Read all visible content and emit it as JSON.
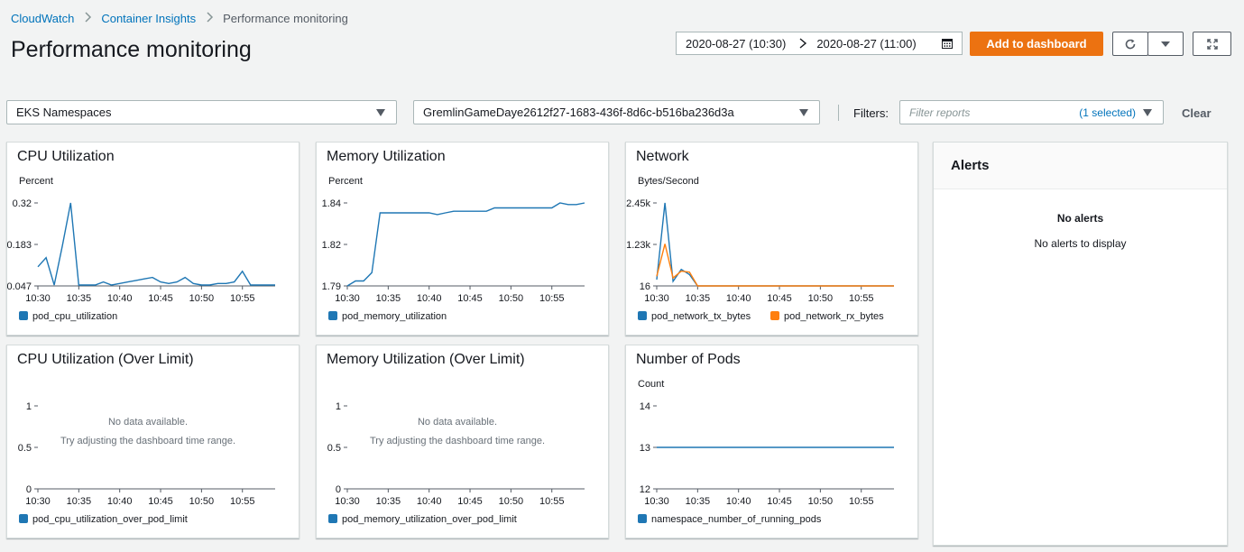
{
  "breadcrumb": {
    "items": [
      "CloudWatch",
      "Container Insights"
    ],
    "current": "Performance monitoring"
  },
  "page": {
    "title": "Performance monitoring"
  },
  "time_range": {
    "start": "2020-08-27 (10:30)",
    "end": "2020-08-27 (11:00)"
  },
  "actions": {
    "add_dashboard": "Add to dashboard"
  },
  "selectors": {
    "resource_type": "EKS Namespaces",
    "cluster": "GremlinGameDaye2612f27-1683-436f-8d6c-b516ba236d3a",
    "filters_label": "Filters:",
    "filter_placeholder": "Filter reports",
    "filter_selected": "(1 selected)",
    "clear": "Clear"
  },
  "colors": {
    "series_blue": "#1f77b4",
    "series_orange": "#ff7f0e",
    "accent": "#ec7211",
    "link": "#0073bb"
  },
  "alerts": {
    "title": "Alerts",
    "heading": "No alerts",
    "message": "No alerts to display"
  },
  "charts": {
    "cpu": {
      "title": "CPU Utilization",
      "unit": "Percent",
      "xticks": [
        "10:30",
        "10:35",
        "10:40",
        "10:45",
        "10:50",
        "10:55"
      ],
      "yticks": [
        "0.32",
        "0.183",
        "0.047"
      ],
      "legend": [
        "pod_cpu_utilization"
      ]
    },
    "mem": {
      "title": "Memory Utilization",
      "unit": "Percent",
      "xticks": [
        "10:30",
        "10:35",
        "10:40",
        "10:45",
        "10:50",
        "10:55"
      ],
      "yticks": [
        "1.84",
        "1.82",
        "1.79"
      ],
      "legend": [
        "pod_memory_utilization"
      ]
    },
    "net": {
      "title": "Network",
      "unit": "Bytes/Second",
      "xticks": [
        "10:30",
        "10:35",
        "10:40",
        "10:45",
        "10:50",
        "10:55"
      ],
      "yticks": [
        "2.45k",
        "1.23k",
        "16"
      ],
      "legend": [
        "pod_network_tx_bytes",
        "pod_network_rx_bytes"
      ]
    },
    "cpu_limit": {
      "title": "CPU Utilization (Over Limit)",
      "xticks": [
        "10:30",
        "10:35",
        "10:40",
        "10:45",
        "10:50",
        "10:55"
      ],
      "yticks": [
        "1",
        "0.5",
        "0"
      ],
      "nodata": "No data available.",
      "nodata_hint": "Try adjusting the dashboard time range.",
      "legend": [
        "pod_cpu_utilization_over_pod_limit"
      ]
    },
    "mem_limit": {
      "title": "Memory Utilization (Over Limit)",
      "xticks": [
        "10:30",
        "10:35",
        "10:40",
        "10:45",
        "10:50",
        "10:55"
      ],
      "yticks": [
        "1",
        "0.5",
        "0"
      ],
      "nodata": "No data available.",
      "nodata_hint": "Try adjusting the dashboard time range.",
      "legend": [
        "pod_memory_utilization_over_pod_limit"
      ]
    },
    "pods": {
      "title": "Number of Pods",
      "unit": "Count",
      "xticks": [
        "10:30",
        "10:35",
        "10:40",
        "10:45",
        "10:50",
        "10:55"
      ],
      "yticks": [
        "14",
        "13",
        "12"
      ],
      "legend": [
        "namespace_number_of_running_pods"
      ]
    }
  },
  "chart_data": [
    {
      "type": "line",
      "title": "CPU Utilization",
      "ylabel": "Percent",
      "x": [
        "10:30",
        "10:31",
        "10:32",
        "10:33",
        "10:34",
        "10:35",
        "10:36",
        "10:37",
        "10:38",
        "10:39",
        "10:40",
        "10:41",
        "10:42",
        "10:43",
        "10:44",
        "10:45",
        "10:46",
        "10:47",
        "10:48",
        "10:49",
        "10:50",
        "10:51",
        "10:52",
        "10:53",
        "10:54",
        "10:55",
        "10:56",
        "10:57",
        "10:58",
        "10:59"
      ],
      "series": [
        {
          "name": "pod_cpu_utilization",
          "values": [
            0.11,
            0.14,
            0.05,
            0.18,
            0.32,
            0.05,
            0.05,
            0.05,
            0.06,
            0.05,
            0.055,
            0.06,
            0.065,
            0.07,
            0.075,
            0.06,
            0.055,
            0.06,
            0.075,
            0.055,
            0.05,
            0.05,
            0.055,
            0.055,
            0.06,
            0.095,
            0.05,
            0.05,
            0.05,
            0.05
          ]
        }
      ],
      "ylim": [
        0.047,
        0.32
      ]
    },
    {
      "type": "line",
      "title": "Memory Utilization",
      "ylabel": "Percent",
      "x": [
        "10:30",
        "10:31",
        "10:32",
        "10:33",
        "10:34",
        "10:35",
        "10:36",
        "10:37",
        "10:38",
        "10:39",
        "10:40",
        "10:41",
        "10:42",
        "10:43",
        "10:44",
        "10:45",
        "10:46",
        "10:47",
        "10:48",
        "10:49",
        "10:50",
        "10:51",
        "10:52",
        "10:53",
        "10:54",
        "10:55",
        "10:56",
        "10:57",
        "10:58",
        "10:59"
      ],
      "series": [
        {
          "name": "pod_memory_utilization",
          "values": [
            1.79,
            1.793,
            1.793,
            1.798,
            1.834,
            1.834,
            1.834,
            1.834,
            1.834,
            1.834,
            1.834,
            1.833,
            1.834,
            1.835,
            1.835,
            1.835,
            1.835,
            1.835,
            1.837,
            1.837,
            1.837,
            1.837,
            1.837,
            1.837,
            1.837,
            1.837,
            1.84,
            1.839,
            1.839,
            1.84
          ]
        }
      ],
      "ylim": [
        1.79,
        1.84
      ]
    },
    {
      "type": "line",
      "title": "Network",
      "ylabel": "Bytes/Second",
      "x": [
        "10:30",
        "10:31",
        "10:32",
        "10:33",
        "10:34",
        "10:35",
        "10:36",
        "10:37",
        "10:38",
        "10:39",
        "10:40",
        "10:41",
        "10:42",
        "10:43",
        "10:44",
        "10:45",
        "10:46",
        "10:47",
        "10:48",
        "10:49",
        "10:50",
        "10:51",
        "10:52",
        "10:53",
        "10:54",
        "10:55",
        "10:56",
        "10:57",
        "10:58",
        "10:59"
      ],
      "series": [
        {
          "name": "pod_network_tx_bytes",
          "values": [
            200,
            2450,
            150,
            500,
            350,
            16,
            16,
            16,
            16,
            16,
            16,
            16,
            16,
            16,
            16,
            16,
            16,
            16,
            16,
            16,
            16,
            16,
            16,
            16,
            16,
            16,
            16,
            16,
            16,
            16
          ]
        },
        {
          "name": "pod_network_rx_bytes",
          "values": [
            300,
            1250,
            250,
            450,
            420,
            16,
            16,
            16,
            16,
            16,
            16,
            16,
            16,
            16,
            16,
            16,
            16,
            16,
            16,
            16,
            16,
            16,
            16,
            16,
            16,
            16,
            16,
            16,
            16,
            16
          ]
        }
      ],
      "ylim": [
        16,
        2450
      ]
    },
    {
      "type": "line",
      "title": "CPU Utilization (Over Limit)",
      "x": [],
      "series": [
        {
          "name": "pod_cpu_utilization_over_pod_limit",
          "values": []
        }
      ],
      "ylim": [
        0,
        1
      ]
    },
    {
      "type": "line",
      "title": "Memory Utilization (Over Limit)",
      "x": [],
      "series": [
        {
          "name": "pod_memory_utilization_over_pod_limit",
          "values": []
        }
      ],
      "ylim": [
        0,
        1
      ]
    },
    {
      "type": "line",
      "title": "Number of Pods",
      "ylabel": "Count",
      "x": [
        "10:30",
        "10:59"
      ],
      "series": [
        {
          "name": "namespace_number_of_running_pods",
          "values": [
            13,
            13
          ]
        }
      ],
      "ylim": [
        12,
        14
      ]
    }
  ]
}
